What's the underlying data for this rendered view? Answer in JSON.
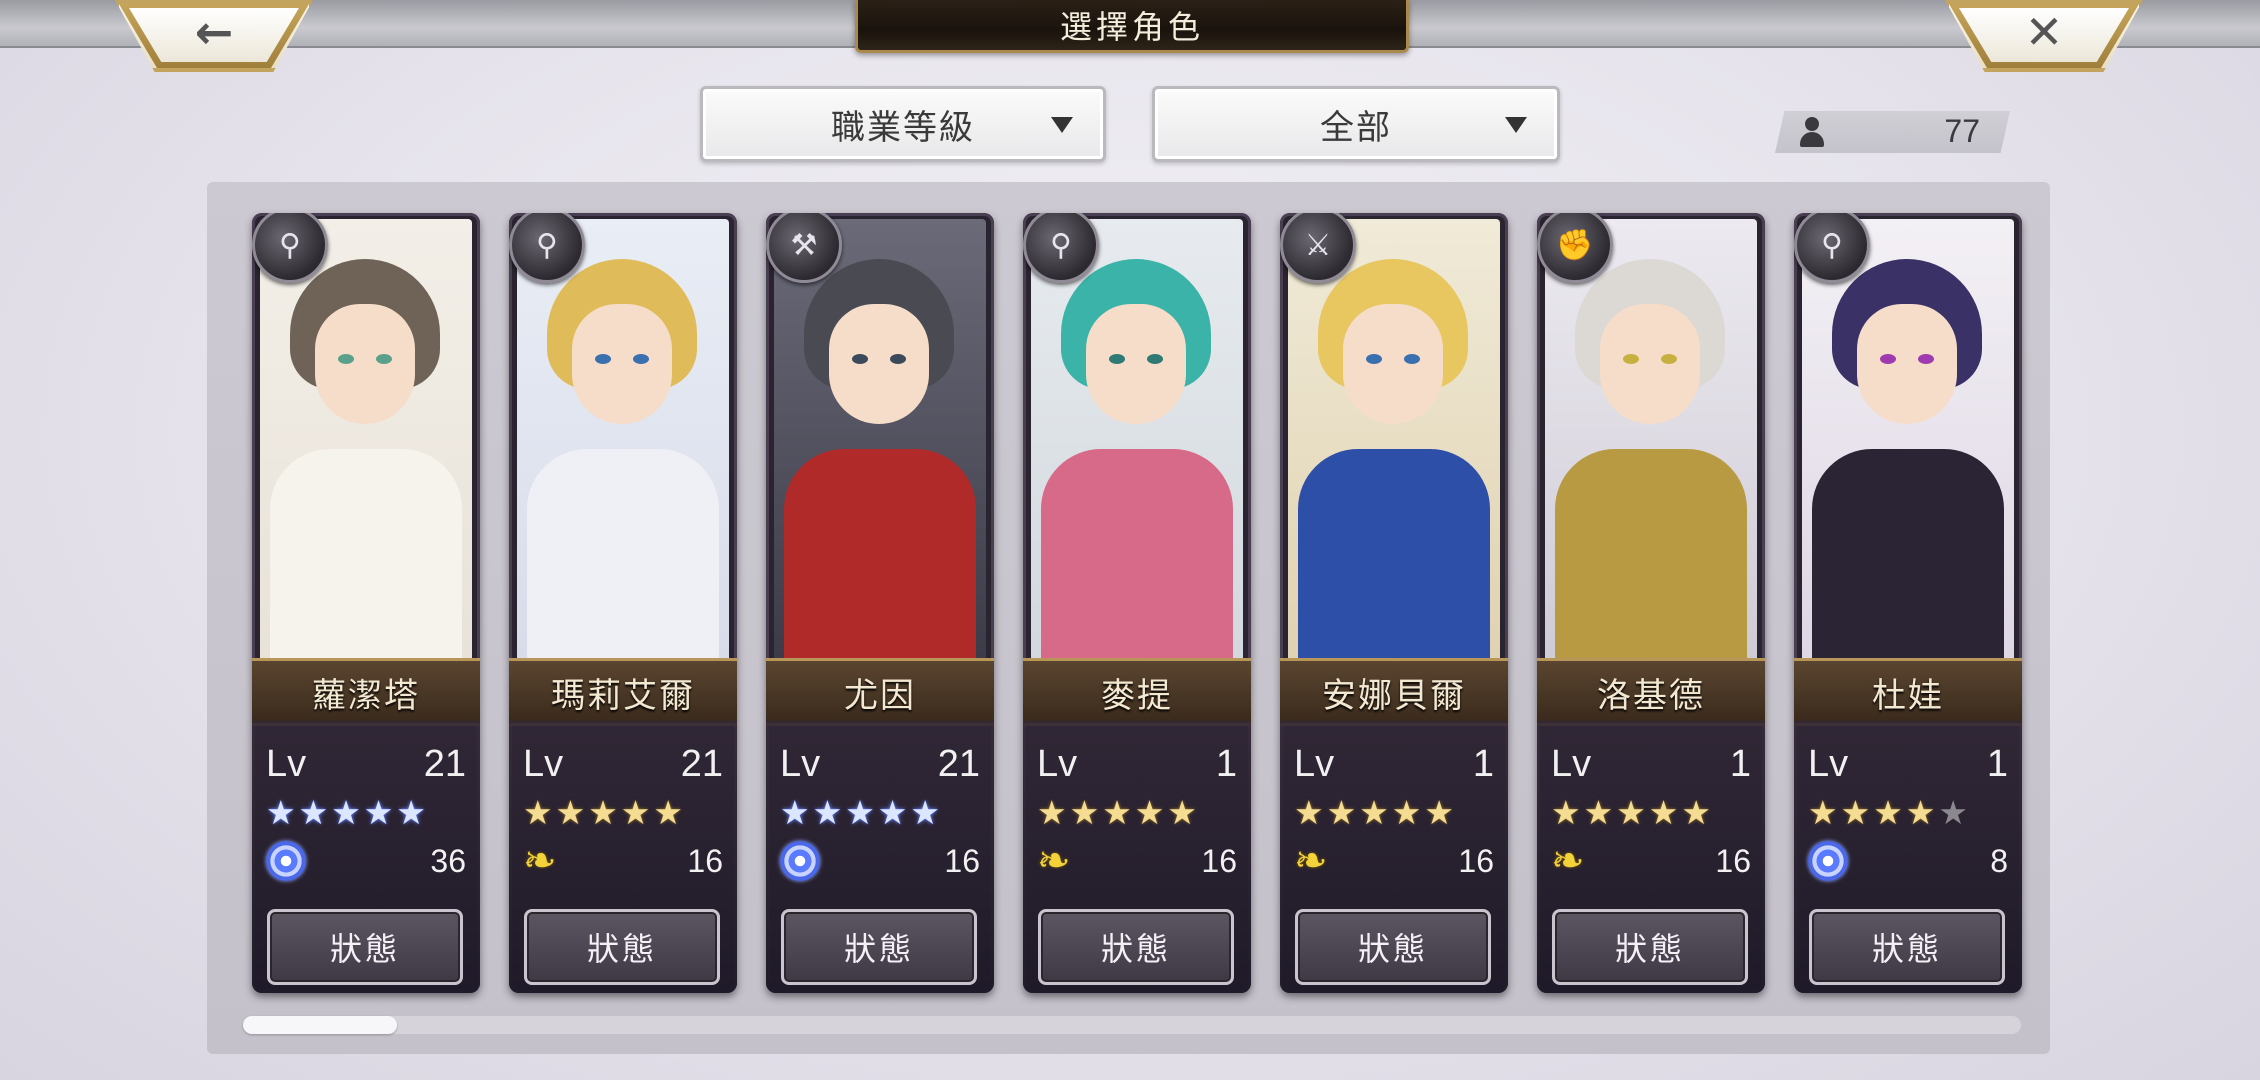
{
  "header": {
    "title": "選擇角色",
    "back_icon": "left-arrow-icon",
    "close_icon": "close-x-icon"
  },
  "filters": {
    "sort_label": "職業等級",
    "filter_label": "全部"
  },
  "character_count": "77",
  "scroll_position": 0,
  "characters": [
    {
      "name": "蘿潔塔",
      "lv_label": "Lv",
      "level": "21",
      "stars": 5,
      "star_type": "blue",
      "type_icon": "staff-icon",
      "element": "swirl",
      "element_value": "36",
      "status_label": "狀態"
    },
    {
      "name": "瑪莉艾爾",
      "lv_label": "Lv",
      "level": "21",
      "stars": 5,
      "star_type": "gold",
      "type_icon": "staff-icon",
      "element": "wing",
      "element_value": "16",
      "status_label": "狀態"
    },
    {
      "name": "尤因",
      "lv_label": "Lv",
      "level": "21",
      "stars": 5,
      "star_type": "blue",
      "type_icon": "hammer-icon",
      "element": "swirl",
      "element_value": "16",
      "status_label": "狀態"
    },
    {
      "name": "麥提",
      "lv_label": "Lv",
      "level": "1",
      "stars": 5,
      "star_type": "gold",
      "type_icon": "staff-icon",
      "element": "wing",
      "element_value": "16",
      "status_label": "狀態"
    },
    {
      "name": "安娜貝爾",
      "lv_label": "Lv",
      "level": "1",
      "stars": 5,
      "star_type": "gold",
      "type_icon": "sword-icon",
      "element": "wing",
      "element_value": "16",
      "status_label": "狀態"
    },
    {
      "name": "洛基德",
      "lv_label": "Lv",
      "level": "1",
      "stars": 5,
      "star_type": "gold",
      "type_icon": "fist-icon",
      "element": "wing",
      "element_value": "16",
      "status_label": "狀態"
    },
    {
      "name": "杜娃",
      "lv_label": "Lv",
      "level": "1",
      "stars": 4,
      "star_type": "gold",
      "type_icon": "staff-icon",
      "element": "swirl",
      "element_value": "8",
      "status_label": "狀態"
    }
  ]
}
